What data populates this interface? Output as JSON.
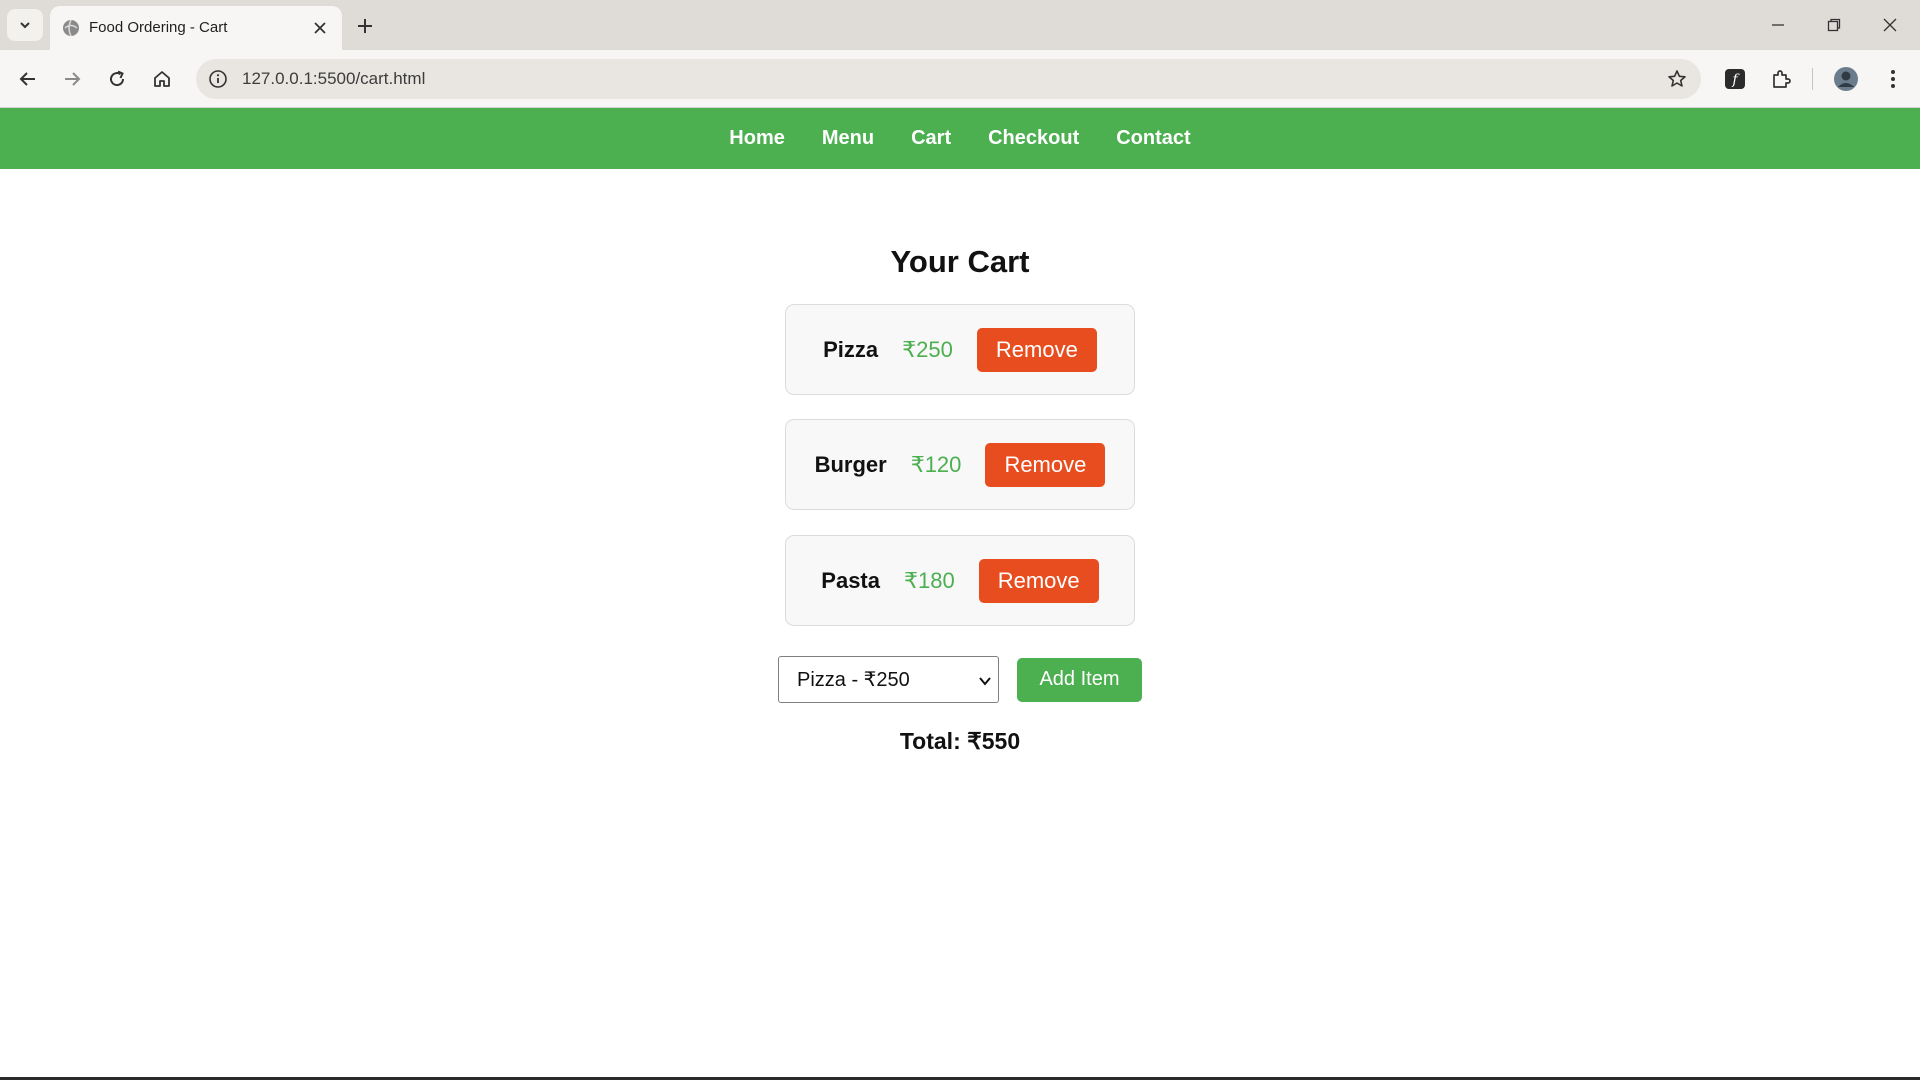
{
  "browser": {
    "tab_title": "Food Ordering - Cart",
    "url": "127.0.0.1:5500/cart.html"
  },
  "nav": {
    "items": [
      {
        "label": "Home"
      },
      {
        "label": "Menu"
      },
      {
        "label": "Cart"
      },
      {
        "label": "Checkout"
      },
      {
        "label": "Contact"
      }
    ]
  },
  "cart": {
    "title": "Your Cart",
    "items": [
      {
        "name": "Pizza",
        "price": "₹250",
        "remove_label": "Remove"
      },
      {
        "name": "Burger",
        "price": "₹120",
        "remove_label": "Remove"
      },
      {
        "name": "Pasta",
        "price": "₹180",
        "remove_label": "Remove"
      }
    ],
    "select_value": "Pizza - ₹250",
    "add_label": "Add Item",
    "total": "Total: ₹550"
  },
  "colors": {
    "nav_bg": "#4caf50",
    "remove_btn": "#e84d1f",
    "add_btn": "#4caf50",
    "price": "#4caf50"
  }
}
